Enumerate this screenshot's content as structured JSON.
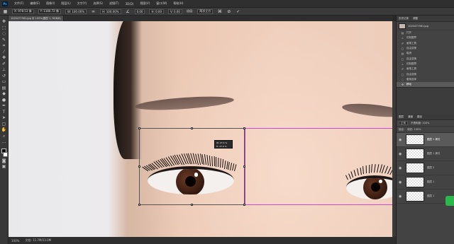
{
  "app": {
    "logo": "Ps"
  },
  "menu": [
    "文件(F)",
    "编辑(E)",
    "图像(I)",
    "图层(L)",
    "文字(Y)",
    "选择(S)",
    "滤镜(T)",
    "3D(D)",
    "视图(V)",
    "窗口(W)",
    "帮助(H)"
  ],
  "options": {
    "x": "X: 978.53 像",
    "y": "Y: 1180.72 像",
    "w": "W: 100.00%",
    "h": "H: 100.00%",
    "angle": "0.00",
    "h_skew": "H: 0.00",
    "v_skew": "V: 0.00",
    "interp_label": "插值:",
    "interp_value": "两次立方",
    "cancel_icon": "cancel-icon",
    "commit_icon": "commit-icon"
  },
  "document": {
    "tab_label": "1020477561.jpg @ 100%(图层 1, RGB/8)"
  },
  "canvas": {
    "tooltip_line1": "W: 27.0 %",
    "tooltip_line2": "H: 27.0 %"
  },
  "status": {
    "zoom": "100%",
    "doc": "文档: 11.7M/23.0M"
  },
  "history_panel": {
    "tabs": [
      "历史记录",
      "调整"
    ],
    "snapshot": "1020477561.jpg",
    "items": [
      {
        "label": "打开",
        "icon": "doc-icon"
      },
      {
        "label": "仿制图章",
        "icon": "stamp-icon"
      },
      {
        "label": "画笔工具",
        "icon": "brush-icon"
      },
      {
        "label": "自由变换",
        "icon": "transform-icon"
      },
      {
        "label": "取消",
        "icon": "doc-icon"
      },
      {
        "label": "自由变换",
        "icon": "transform-icon"
      },
      {
        "label": "仿制图章",
        "icon": "stamp-icon"
      },
      {
        "label": "画笔工具",
        "icon": "brush-icon"
      },
      {
        "label": "自由变换",
        "icon": "transform-icon"
      },
      {
        "label": "套索选择",
        "icon": "lasso-icon"
      },
      {
        "label": "移动",
        "icon": "move-icon"
      }
    ]
  },
  "layers_panel": {
    "tabs": [
      "图层",
      "通道",
      "路径"
    ],
    "blend_mode": "正常",
    "opacity": "不透明度: 100%",
    "lock_label": "锁定:",
    "fill": "填充: 100%",
    "layers": [
      {
        "name": "图层 1 拷贝",
        "selected": true
      },
      {
        "name": "图层 1 拷贝",
        "selected": false
      },
      {
        "name": "图层 2",
        "selected": false
      },
      {
        "name": "图层 1",
        "selected": false
      },
      {
        "name": "图层 1",
        "selected": false
      }
    ]
  }
}
